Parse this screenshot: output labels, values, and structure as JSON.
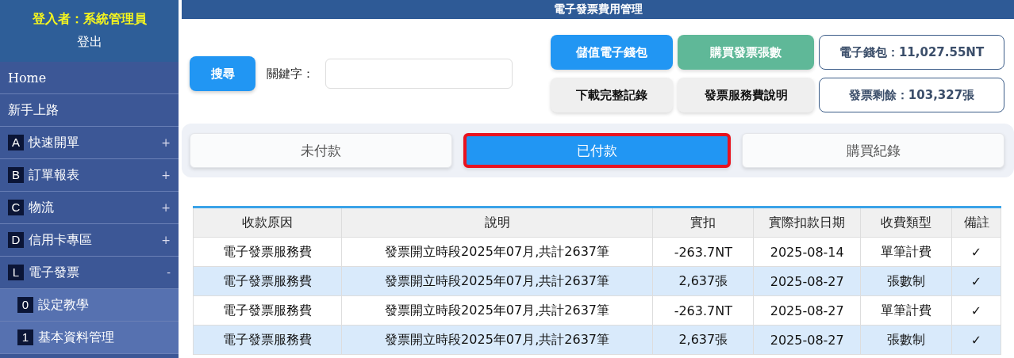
{
  "sidebar": {
    "user_label": "登入者：系統管理員",
    "logout": "登出",
    "items": [
      {
        "label": "Home"
      },
      {
        "label": "新手上路"
      },
      {
        "key": "A",
        "label": "快速開單",
        "sign": "+"
      },
      {
        "key": "B",
        "label": "訂單報表",
        "sign": "+"
      },
      {
        "key": "C",
        "label": "物流",
        "sign": "+"
      },
      {
        "key": "D",
        "label": "信用卡專區",
        "sign": "+"
      },
      {
        "key": "L",
        "label": "電子發票",
        "sign": "-",
        "expanded": true,
        "children": [
          {
            "key": "0",
            "label": "設定教學"
          },
          {
            "key": "1",
            "label": "基本資料管理"
          }
        ]
      }
    ]
  },
  "header": {
    "title": "電子發票費用管理"
  },
  "search": {
    "button": "搜尋",
    "label": "關鍵字："
  },
  "actions": [
    {
      "label": "儲值電子錢包",
      "kind": "primary"
    },
    {
      "label": "購買發票張數",
      "kind": "success"
    },
    {
      "label": "下載完整記錄",
      "kind": "plain"
    },
    {
      "label": "發票服務費說明",
      "kind": "plain"
    }
  ],
  "balances": [
    {
      "text": "電子錢包：11,027.55NT"
    },
    {
      "text": "發票剩餘：103,327張"
    }
  ],
  "tabs": [
    {
      "label": "未付款",
      "selected": false
    },
    {
      "label": "已付款",
      "selected": true
    },
    {
      "label": "購買紀錄",
      "selected": false
    }
  ],
  "table": {
    "columns": [
      "收款原因",
      "說明",
      "實扣",
      "實際扣款日期",
      "收費類型",
      "備註"
    ],
    "rows": [
      [
        "電子發票服務費",
        "發票開立時段2025年07月,共計2637筆",
        "-263.7NT",
        "2025-08-14",
        "單筆計費",
        "✓"
      ],
      [
        "電子發票服務費",
        "發票開立時段2025年07月,共計2637筆",
        "2,637張",
        "2025-08-27",
        "張數制",
        "✓"
      ],
      [
        "電子發票服務費",
        "發票開立時段2025年07月,共計2637筆",
        "-263.7NT",
        "2025-08-27",
        "單筆計費",
        "✓"
      ],
      [
        "電子發票服務費",
        "發票開立時段2025年07月,共計2637筆",
        "2,637張",
        "2025-08-27",
        "張數制",
        "✓"
      ]
    ]
  }
}
